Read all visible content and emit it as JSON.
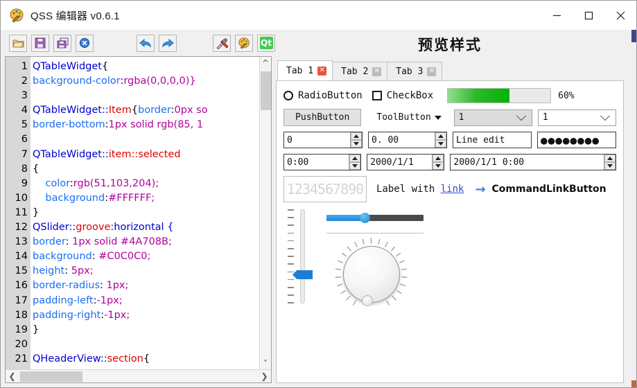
{
  "window": {
    "title": "QSS 编辑器 v0.6.1",
    "app_icon": "palette-icon",
    "minimize": "—",
    "maximize": "□",
    "close": "✕"
  },
  "toolbar": {
    "buttons": [
      {
        "name": "open-file-button",
        "icon": "folder-open-icon"
      },
      {
        "name": "save-button",
        "icon": "floppy-save-icon"
      },
      {
        "name": "save-as-button",
        "icon": "floppy-save-as-icon"
      },
      {
        "name": "close-file-button",
        "icon": "close-circle-icon"
      },
      {
        "name": "undo-button",
        "icon": "undo-arrow-icon"
      },
      {
        "name": "redo-button",
        "icon": "redo-arrow-icon"
      },
      {
        "name": "tools-button",
        "icon": "hammer-screwdriver-icon"
      },
      {
        "name": "style-button",
        "icon": "palette-icon"
      },
      {
        "name": "qt-button",
        "icon": "qt-logo-icon",
        "label": "Qt"
      }
    ]
  },
  "editor": {
    "line_numbers": [
      "1",
      "2",
      "3",
      "4",
      "5",
      "6",
      "7",
      "8",
      "9",
      "10",
      "11",
      "12",
      "13",
      "14",
      "15",
      "16",
      "17",
      "18",
      "19",
      "20",
      "21"
    ],
    "lines": [
      [
        {
          "t": "QTableWidget",
          "c": "sel"
        },
        {
          "t": "{",
          "c": "plain"
        }
      ],
      [
        {
          "t": "background-color",
          "c": "prop"
        },
        {
          "t": ":",
          "c": "plain"
        },
        {
          "t": "rgba(0,0,0,0)}",
          "c": "val"
        }
      ],
      [],
      [
        {
          "t": "QTableWidget::",
          "c": "sel"
        },
        {
          "t": "Item",
          "c": "pseudo"
        },
        {
          "t": "{",
          "c": "plain"
        },
        {
          "t": "border",
          "c": "prop"
        },
        {
          "t": ":",
          "c": "plain"
        },
        {
          "t": "0px so",
          "c": "val"
        }
      ],
      [
        {
          "t": "border-bottom",
          "c": "prop"
        },
        {
          "t": ":",
          "c": "plain"
        },
        {
          "t": "1px solid rgb(85, 1",
          "c": "val"
        }
      ],
      [],
      [
        {
          "t": "QTableWidget::",
          "c": "sel"
        },
        {
          "t": "item::selected",
          "c": "pseudo"
        }
      ],
      [
        {
          "t": "{",
          "c": "plain"
        }
      ],
      [
        {
          "t": "    color",
          "c": "prop"
        },
        {
          "t": ":",
          "c": "plain"
        },
        {
          "t": "rgb(51,103,204);",
          "c": "val"
        }
      ],
      [
        {
          "t": "    background",
          "c": "prop"
        },
        {
          "t": ":",
          "c": "plain"
        },
        {
          "t": "#FFFFFF;",
          "c": "val"
        }
      ],
      [
        {
          "t": "}",
          "c": "plain"
        }
      ],
      [
        {
          "t": "QSlider::",
          "c": "sel"
        },
        {
          "t": "groove",
          "c": "pseudo"
        },
        {
          "t": ":horizontal {",
          "c": "sel"
        }
      ],
      [
        {
          "t": "border",
          "c": "prop"
        },
        {
          "t": ": ",
          "c": "plain"
        },
        {
          "t": "1px solid #4A708B;",
          "c": "val"
        }
      ],
      [
        {
          "t": "background",
          "c": "prop"
        },
        {
          "t": ": ",
          "c": "plain"
        },
        {
          "t": "#C0C0C0;",
          "c": "val"
        }
      ],
      [
        {
          "t": "height",
          "c": "prop"
        },
        {
          "t": ": ",
          "c": "plain"
        },
        {
          "t": "5px;",
          "c": "val"
        }
      ],
      [
        {
          "t": "border-radius",
          "c": "prop"
        },
        {
          "t": ": ",
          "c": "plain"
        },
        {
          "t": "1px;",
          "c": "val"
        }
      ],
      [
        {
          "t": "padding-left",
          "c": "prop"
        },
        {
          "t": ":",
          "c": "plain"
        },
        {
          "t": "-1px;",
          "c": "val"
        }
      ],
      [
        {
          "t": "padding-right",
          "c": "prop"
        },
        {
          "t": ":",
          "c": "plain"
        },
        {
          "t": "-1px;",
          "c": "val"
        }
      ],
      [
        {
          "t": "}",
          "c": "plain"
        }
      ],
      [],
      [
        {
          "t": "QHeaderView::",
          "c": "sel"
        },
        {
          "t": "section",
          "c": "pseudo"
        },
        {
          "t": "{",
          "c": "plain"
        }
      ]
    ]
  },
  "preview": {
    "title": "预览样式",
    "tabs": [
      {
        "label": "Tab 1",
        "active": true,
        "close": "✕"
      },
      {
        "label": "Tab 2",
        "active": false,
        "close": "✕"
      },
      {
        "label": "Tab 3",
        "active": false,
        "close": "✕"
      }
    ],
    "radio_label": "RadioButton",
    "check_label": "CheckBox",
    "progress": {
      "value": 60,
      "text": "60%"
    },
    "push_button": "PushButton",
    "tool_button": "ToolButton",
    "combo_readonly_value": "1",
    "combo_editable_value": "1",
    "spin_int": "0",
    "spin_double": "0. 00",
    "line_edit": "Line edit",
    "password_dots": "●●●●●●●●",
    "time_edit": "0:00",
    "date_edit": "2000/1/1",
    "datetime_edit": "2000/1/1 0:00",
    "lcd_number": "1234567890",
    "label_text": "Label with ",
    "label_link": "link",
    "command_link": "CommandLinkButton",
    "command_arrow": "→",
    "slider_vertical_value": 35,
    "slider_horizontal_value": 38,
    "dial_value": 18
  },
  "colors": {
    "accent_green": "#00b400",
    "accent_blue": "#1a7fd4",
    "tab_close_active": "#e8543a",
    "tab_close_inactive": "#bcbcbc",
    "qt_green": "#41cd52",
    "selector_blue": "#0000d0",
    "pseudo_red": "#e00000",
    "property_blue": "#1a6ef5",
    "value_magenta": "#b0009b"
  }
}
